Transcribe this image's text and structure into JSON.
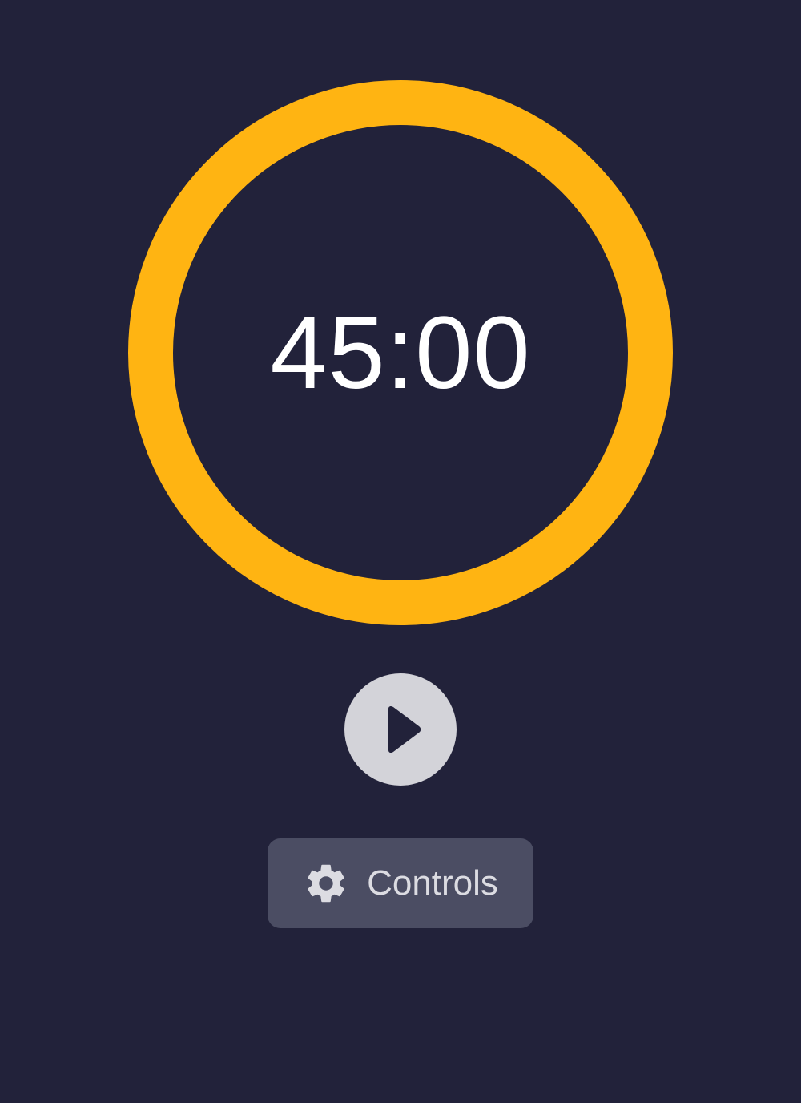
{
  "timer": {
    "display": "45:00",
    "progress": 1.0,
    "ring_color": "#ffb412",
    "background_color": "#22223a"
  },
  "play_button": {
    "icon": "play-icon",
    "color": "#d3d3d9"
  },
  "controls_button": {
    "icon": "gear-icon",
    "label": "Controls"
  }
}
